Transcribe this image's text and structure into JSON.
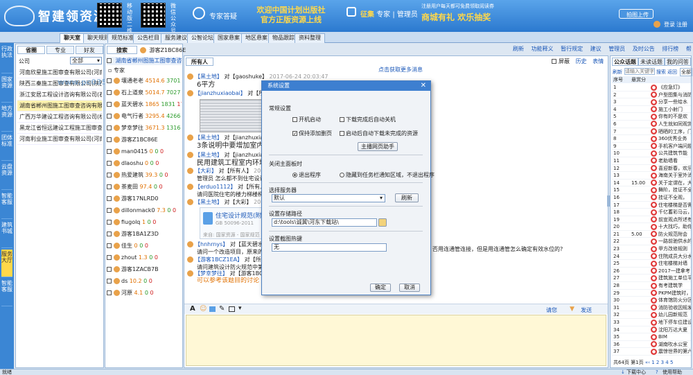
{
  "header": {
    "logo": "智建领资源",
    "qr1_label": "移动版二维",
    "qr2_label": "微信公众号",
    "expert_btn": "专家答疑",
    "marquee_line1": "欢迎中国计划出版社",
    "marquee_line2": "官方正版资源上线",
    "recruit_prefix": "征集",
    "recruit_expert": "专家",
    "recruit_admin": "管理员",
    "notice_line1": "注册用户每天都可免费领取阅读券",
    "notice_line2a": "商城有礼",
    "notice_line2b": "欢乐抽奖",
    "cloud_upload": "拍图上传",
    "login": "登录",
    "register": "注册"
  },
  "nav_tabs": [
    "聊天室",
    "聊天规则",
    "规范标准",
    "公告栏目",
    "服务建议",
    "公智论坛",
    "国家悬案",
    "地区悬案",
    "物品跟踪",
    "资料整理"
  ],
  "sidebar": [
    "行政执法",
    "国家资源",
    "地方资源",
    "团体标准",
    "云盘资源",
    "智能客服",
    "建筑书城",
    "服务大厅",
    "智能客服"
  ],
  "watermark": "www.pc0359.cn",
  "left_panel": {
    "tabs": [
      "省圈",
      "专业",
      "好友",
      "搜索"
    ],
    "guest_name": "游客Z1BC86E",
    "company_label": "公司",
    "company_filter": "全部",
    "companies": [
      "河南欣星施工图审查有限公司(河南省",
      "陕西三秦施工图审查有限公司(陕西省",
      "浙江安居工程设计咨询有限公司(石家",
      "湖南省郴州图施工图审查咨询有限",
      "广西万华建设工程咨询有限公司(梧州",
      "黑龙江省恒远建设工程施工图审查有",
      "河南利业施工图审查有限公司(河南省"
    ]
  },
  "mid_panel": {
    "header": "湖南省郴州图施工图审查咨询有",
    "expert_label": "专家",
    "users": [
      {
        "name": "壤通老老",
        "score": "4514.6",
        "a": "3701",
        "b": "31"
      },
      {
        "name": "石上道泉",
        "score": "5014.7",
        "a": "7027",
        "b": "70"
      },
      {
        "name": "蓝天碧水",
        "score": "1865",
        "a": "1831",
        "b": "1749"
      },
      {
        "name": "电气行者",
        "score": "3295.4",
        "a": "4266",
        "b": "4"
      },
      {
        "name": "梦幸梦往",
        "score": "3671.3",
        "a": "1316",
        "b": "13"
      },
      {
        "name": "游客Z1BC86E",
        "score": "",
        "a": "",
        "b": ""
      },
      {
        "name": "man0415",
        "score": "0",
        "a": "0",
        "b": "0"
      },
      {
        "name": "dlaoshu",
        "score": "0",
        "a": "0",
        "b": "0"
      },
      {
        "name": "热爱建筑",
        "score": "39.3",
        "a": "0",
        "b": "0"
      },
      {
        "name": "茶麦田",
        "score": "97.4",
        "a": "0",
        "b": "0"
      },
      {
        "name": "游客17NLRD0",
        "score": "",
        "a": "",
        "b": ""
      },
      {
        "name": "dillonmack0",
        "score": "7.3",
        "a": "0",
        "b": "0"
      },
      {
        "name": "fiugolq",
        "score": "1",
        "a": "0",
        "b": "0"
      },
      {
        "name": "游客1BA1Z3D",
        "score": "",
        "a": "",
        "b": ""
      },
      {
        "name": "佳生",
        "score": "0",
        "a": "0",
        "b": "0"
      },
      {
        "name": "zhout",
        "score": "1.3",
        "a": "0",
        "b": "0"
      },
      {
        "name": "游客1ZACB7B",
        "score": "",
        "a": "",
        "b": ""
      },
      {
        "name": "ds",
        "score": "10.2",
        "a": "0",
        "b": "0"
      },
      {
        "name": "河原",
        "score": "4.1",
        "a": "0",
        "b": "0"
      }
    ]
  },
  "toolbar_right": [
    "刷新",
    "功能释义",
    "暂行规定",
    "建议",
    "管理员",
    "及时公告",
    "排行榜",
    "帮助"
  ],
  "chat": {
    "tab": "所有人",
    "toggles": [
      "屏蔽",
      "历史",
      "表情"
    ],
    "click_more": "点击获取更多消息",
    "messages": [
      {
        "from": "【黑土地】",
        "to": "对【gaoshuke】",
        "time": "2017-06-24 20:03:47",
        "text": "6平方"
      },
      {
        "from": "【jianzhuxiaobai】",
        "to": "对【所有人】",
        "time": "",
        "text": ""
      },
      {
        "from": "【黑土地】",
        "to": "对【jianzhuxiaobai】",
        "time": "",
        "text": "3条说明中要增加室内环境污"
      },
      {
        "from": "【黑土地】",
        "to": "对【jianzhuxiaobai】",
        "time": "",
        "text": "民用建筑工程室内环境污"
      },
      {
        "from": "【大彩】",
        "to": "对【所有人】",
        "time": "2017",
        "text": "管理员 怎么都不到住宅设计规范"
      },
      {
        "from": "【erduo1112】",
        "to": "对【所有人】",
        "time": "",
        "text": "请问医院住宅的楼力梯楼梯，前室"
      },
      {
        "from": "【黑土地】",
        "to": "对【大彩】",
        "time": "2017-06-0",
        "text": ""
      },
      {
        "from": "【hnhrnys】",
        "to": "对【蓝天碧水】",
        "time": "",
        "text": "请问一个改造项目，原来的消防"
      },
      {
        "from": "【游客1BCZ1EA】",
        "to": "对【所有人】",
        "time": "",
        "text": "请问建筑设计防火规范中第5.5.1"
      },
      {
        "from": "【梦幸梦往】",
        "to": "对【游客1BCZ1EA】",
        "time": "",
        "text": "可以参考该题目的讨论"
      }
    ],
    "card_title": "住宅设计规范(附",
    "card_code": "GB 50096-2011",
    "card_source": "来自: 国家资源 - 国家规范",
    "right_text": "否用连通管连接，但是用连通管怎么确定有效水位的?",
    "input_hint": "请您",
    "send": "发送"
  },
  "dialog": {
    "title": "系统设置",
    "sec_general": "常规设置",
    "cb_startup": "开机启动",
    "cb_shutdown": "下载完成后自动关机",
    "cb_float": "保持添加删页",
    "cb_auto_download": "启动后自动下载未完成的资源",
    "btn_helper": "主播网页助手",
    "sec_close": "关闭主面板时",
    "radio_exit": "退出程序",
    "radio_tray": "隐藏到任务栏通知区域，不退出程序",
    "sec_server": "选择服务器",
    "server_value": "默认",
    "btn_refresh": "刷新",
    "sec_path": "设置存储路径",
    "path_value": "d:\\tools\\诚冀\\河东下载站\\",
    "sec_hotkey": "设置截图热键",
    "hotkey_value": "无",
    "btn_ok": "确定",
    "btn_cancel": "取消"
  },
  "right_panel": {
    "tabs": [
      "公众话题",
      "未读话题",
      "我的问答"
    ],
    "refresh": "刷新",
    "search_placeholder": "请输入关键字",
    "search_btn": "搜索",
    "back_btn": "返回",
    "all_btn": "全部",
    "col_no": "序号",
    "col_reward": "悬赏分",
    "items": [
      {
        "no": "1",
        "reward": "",
        "title": "《应急灯》"
      },
      {
        "no": "2",
        "reward": "",
        "title": "户型图集与消防"
      },
      {
        "no": "3",
        "reward": "",
        "title": "分享一些给水"
      },
      {
        "no": "4",
        "reward": "",
        "title": "施工小射门"
      },
      {
        "no": "5",
        "reward": "",
        "title": "你有的不是欢"
      },
      {
        "no": "6",
        "reward": "",
        "title": "人生就如同观赏"
      },
      {
        "no": "7",
        "reward": "",
        "title": "晒晒的工序，门"
      },
      {
        "no": "8",
        "reward": "",
        "title": "360优秀业务"
      },
      {
        "no": "9",
        "reward": "",
        "title": "手机客户端问题"
      },
      {
        "no": "10",
        "reward": "",
        "title": "公共建筑节能"
      },
      {
        "no": "11",
        "reward": "",
        "title": "老助墙看"
      },
      {
        "no": "12",
        "reward": "",
        "title": "喜迎新春，欢乐"
      },
      {
        "no": "13",
        "reward": "",
        "title": "海南关于室外消"
      },
      {
        "no": "14",
        "reward": "15.00",
        "title": "关于定谓在，大"
      },
      {
        "no": "15",
        "reward": "",
        "title": "舞阶，挂证不全"
      },
      {
        "no": "16",
        "reward": "",
        "title": "挂证不全观，"
      },
      {
        "no": "17",
        "reward": "",
        "title": "住宅楼梯是否需"
      },
      {
        "no": "18",
        "reward": "",
        "title": "千亿蓄彩马云，"
      },
      {
        "no": "19",
        "reward": "",
        "title": "前宣观点所述有"
      },
      {
        "no": "20",
        "reward": "",
        "title": "十大找巧，助你"
      },
      {
        "no": "21",
        "reward": "5.00",
        "title": "防火规范附会"
      },
      {
        "no": "22",
        "reward": "",
        "title": "一路前驰供水的"
      },
      {
        "no": "23",
        "reward": "",
        "title": "甲方改修规则"
      },
      {
        "no": "24",
        "reward": "",
        "title": "住院成员大分水"
      },
      {
        "no": "25",
        "reward": "",
        "title": "住宅楼梯对墙"
      },
      {
        "no": "26",
        "reward": "",
        "title": "2017一建拿考"
      },
      {
        "no": "27",
        "reward": "",
        "title": "建筑施工单位平"
      },
      {
        "no": "28",
        "reward": "",
        "title": "有考建筑学"
      },
      {
        "no": "29",
        "reward": "",
        "title": "PKPM建筑时，次"
      },
      {
        "no": "30",
        "reward": "",
        "title": "体育馆防火分区"
      },
      {
        "no": "31",
        "reward": "",
        "title": "消防验收因规发生"
      },
      {
        "no": "32",
        "reward": "",
        "title": "幼儿园新规范"
      },
      {
        "no": "33",
        "reward": "",
        "title": "地下停车位建设"
      },
      {
        "no": "34",
        "reward": "",
        "title": "沈阳万达大夏"
      },
      {
        "no": "35",
        "reward": "",
        "title": "BIM"
      },
      {
        "no": "36",
        "reward": "",
        "title": "湖南吹水公室"
      },
      {
        "no": "37",
        "reward": "",
        "title": "震惊世界的第六面"
      }
    ],
    "footer_total": "共64页",
    "footer_page": "第1页",
    "pages": [
      "1",
      "2",
      "3",
      "4",
      "5"
    ]
  },
  "statusbar": {
    "left": "就绪",
    "download_center": "下载中心",
    "help": "使用帮助"
  }
}
